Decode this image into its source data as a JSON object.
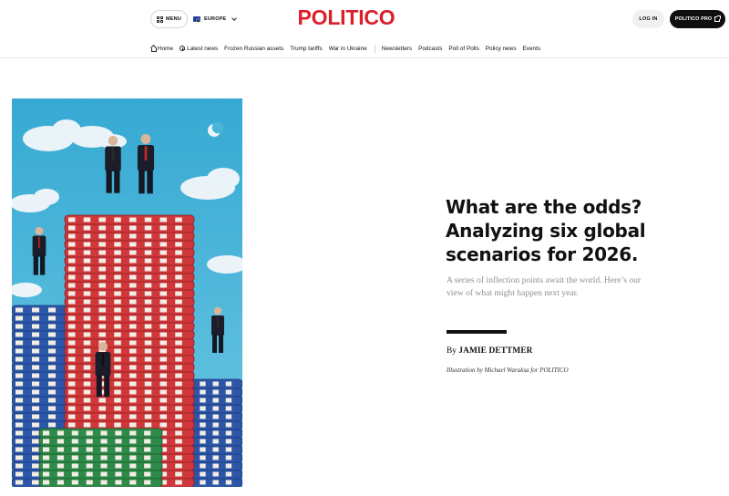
{
  "header": {
    "menu_label": "MENU",
    "edition_label": "EUROPE",
    "logo_text": "POLITICO",
    "login_label": "LOG IN",
    "pro_label": "POLITICO PRO"
  },
  "nav": {
    "items": [
      {
        "label": "Home",
        "icon": "home-icon"
      },
      {
        "label": "Latest news",
        "icon": "clock-icon"
      },
      {
        "label": "Frozen Russian assets"
      },
      {
        "label": "Trump tariffs"
      },
      {
        "label": "War in Ukraine"
      },
      {
        "label": "Newsletters"
      },
      {
        "label": "Podcasts"
      },
      {
        "label": "Poll of Polls"
      },
      {
        "label": "Policy news"
      },
      {
        "label": "Events"
      }
    ]
  },
  "article": {
    "headline_lines": [
      "What are the odds?",
      "Analyzing six global",
      "scenarios for 2026."
    ],
    "dek_lines": [
      "A series of inflection points await the world. Here’s our",
      "view of what might happen next year."
    ],
    "byline_prefix": "By",
    "author": "JAMIE DETTMER",
    "illustration_credit": "Illustration by Michael Waraksa for POLITICO"
  },
  "colors": {
    "brand_red": "#dc1e2b",
    "sky": "#3fb6d8",
    "chip_red": "#d0373a",
    "chip_blue": "#2c56a8",
    "chip_green": "#2f8a4a"
  }
}
